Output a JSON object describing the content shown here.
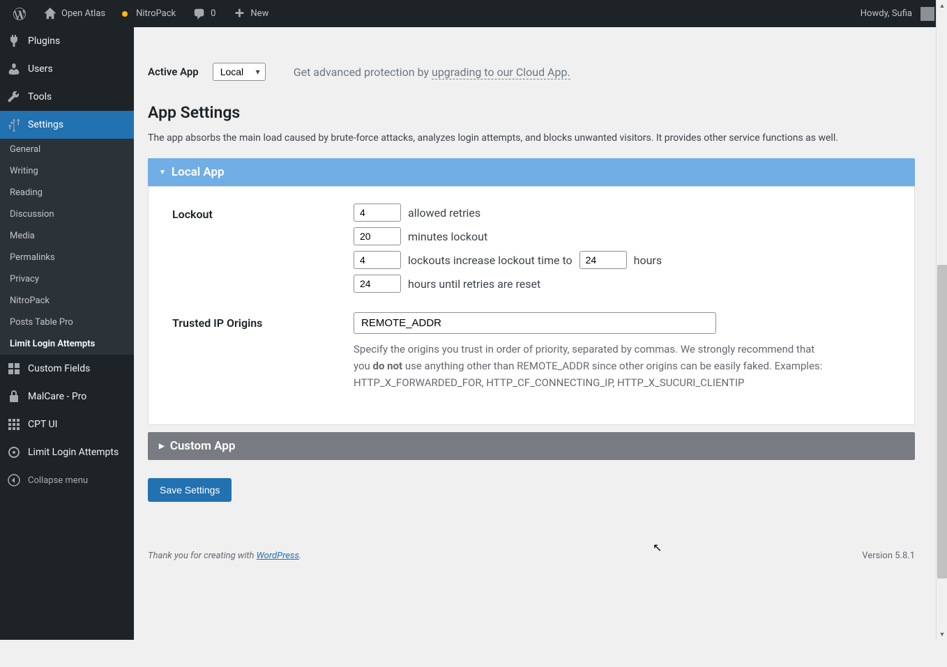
{
  "adminbar": {
    "site_name": "Open Atlas",
    "nitropack": "NitroPack",
    "comments": "0",
    "new": "New",
    "howdy": "Howdy, Sufia"
  },
  "sidebar": {
    "items": [
      {
        "label": "Plugins"
      },
      {
        "label": "Users"
      },
      {
        "label": "Tools"
      },
      {
        "label": "Settings"
      },
      {
        "label": "Custom Fields"
      },
      {
        "label": "MalCare - Pro"
      },
      {
        "label": "CPT UI"
      },
      {
        "label": "Limit Login Attempts"
      }
    ],
    "submenu": [
      {
        "label": "General"
      },
      {
        "label": "Writing"
      },
      {
        "label": "Reading"
      },
      {
        "label": "Discussion"
      },
      {
        "label": "Media"
      },
      {
        "label": "Permalinks"
      },
      {
        "label": "Privacy"
      },
      {
        "label": "NitroPack"
      },
      {
        "label": "Posts Table Pro"
      },
      {
        "label": "Limit Login Attempts"
      }
    ],
    "collapse": "Collapse menu"
  },
  "active_app": {
    "label": "Active App",
    "select_value": "Local",
    "protection_prefix": "Get advanced protection by ",
    "protection_link": "upgrading to our Cloud App."
  },
  "settings": {
    "title": "App Settings",
    "desc": "The app absorbs the main load caused by brute-force attacks, analyzes login attempts, and blocks unwanted visitors. It provides other service functions as well."
  },
  "accordion": {
    "local_title": "Local App",
    "custom_title": "Custom App"
  },
  "lockout": {
    "label": "Lockout",
    "allowed_retries_value": "4",
    "allowed_retries_text": "allowed retries",
    "minutes_value": "20",
    "minutes_text": "minutes lockout",
    "lockouts_value": "4",
    "lockouts_text1": "lockouts increase lockout time to",
    "lockouts_hours_value": "24",
    "lockouts_text2": "hours",
    "reset_value": "24",
    "reset_text": "hours until retries are reset"
  },
  "trusted": {
    "label": "Trusted IP Origins",
    "value": "REMOTE_ADDR",
    "help_1": "Specify the origins you trust in order of priority, separated by commas. We strongly recommend that you ",
    "help_strong": "do not",
    "help_2": " use anything other than REMOTE_ADDR since other origins can be easily faked. Examples: HTTP_X_FORWARDED_FOR, HTTP_CF_CONNECTING_IP, HTTP_X_SUCURI_CLIENTIP"
  },
  "buttons": {
    "save": "Save Settings"
  },
  "footer": {
    "thanks_prefix": "Thank you for creating with ",
    "wp": "WordPress",
    "period": ".",
    "version": "Version 5.8.1"
  }
}
